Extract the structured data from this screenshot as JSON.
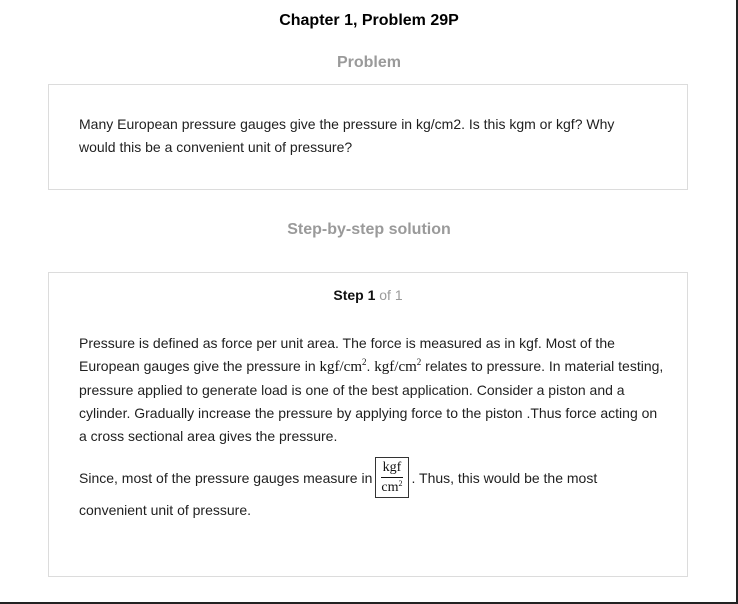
{
  "header": {
    "chapter_title": "Chapter 1, Problem 29P",
    "problem_heading": "Problem",
    "solution_heading": "Step-by-step solution"
  },
  "problem": {
    "text": "Many European pressure gauges give the pressure in kg/cm2. Is this kgm or kgf? Why would this be a convenient unit of pressure?"
  },
  "solution": {
    "step_label": "Step 1",
    "step_of": "of 1",
    "p1_part1": "Pressure is defined as force per unit area. The force is measured as in kgf. Most of the European gauges give the pressure in ",
    "unit_base": "kgf/cm",
    "unit_exp": "2",
    "p1_sep": ".",
    "p1_part2": " relates to pressure. In material testing, pressure applied to generate load is one of the best application. Consider a piston and a cylinder. Gradually increase the pressure by applying force to the piston .Thus force acting on a cross sectional area gives the pressure.",
    "p2_part1": "Since, most of the pressure gauges measure in ",
    "frac_num": "kgf",
    "frac_den": "cm",
    "frac_exp": "2",
    "p2_part2": ". Thus, this would be the most",
    "p2_tail": "convenient unit of pressure."
  }
}
